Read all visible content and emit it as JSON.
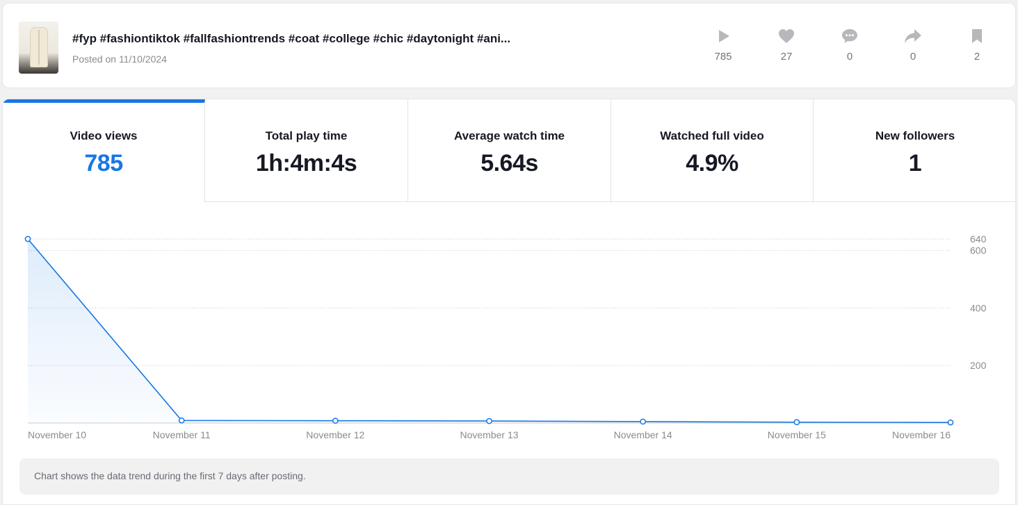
{
  "post": {
    "title": "#fyp #fashiontiktok #fallfashiontrends #coat #college #chic #daytonight #ani...",
    "date": "Posted on 11/10/2024",
    "stats": [
      {
        "icon": "play-icon",
        "value": "785"
      },
      {
        "icon": "heart-icon",
        "value": "27"
      },
      {
        "icon": "comment-icon",
        "value": "0"
      },
      {
        "icon": "share-icon",
        "value": "0"
      },
      {
        "icon": "bookmark-icon",
        "value": "2"
      }
    ]
  },
  "metrics": [
    {
      "label": "Video views",
      "value": "785"
    },
    {
      "label": "Total play time",
      "value": "1h:4m:4s"
    },
    {
      "label": "Average watch time",
      "value": "5.64s"
    },
    {
      "label": "Watched full video",
      "value": "4.9%"
    },
    {
      "label": "New followers",
      "value": "1"
    }
  ],
  "colors": {
    "accent": "#1677e5",
    "text": "#161823",
    "muted": "#8a8b91",
    "icon": "#b7b8bc"
  },
  "chart_data": {
    "type": "line",
    "x": [
      "November 10",
      "November 11",
      "November 12",
      "November 13",
      "November 14",
      "November 15",
      "November 16"
    ],
    "series": [
      {
        "values": [
          640,
          9,
          8,
          7,
          5,
          3,
          2
        ]
      }
    ],
    "y_ticks": [
      200,
      400,
      600,
      640
    ],
    "ylim": [
      0,
      640
    ],
    "grid": true,
    "y_axis_position": "right",
    "area_fill": true
  },
  "note": "Chart shows the data trend during the first 7 days after posting."
}
